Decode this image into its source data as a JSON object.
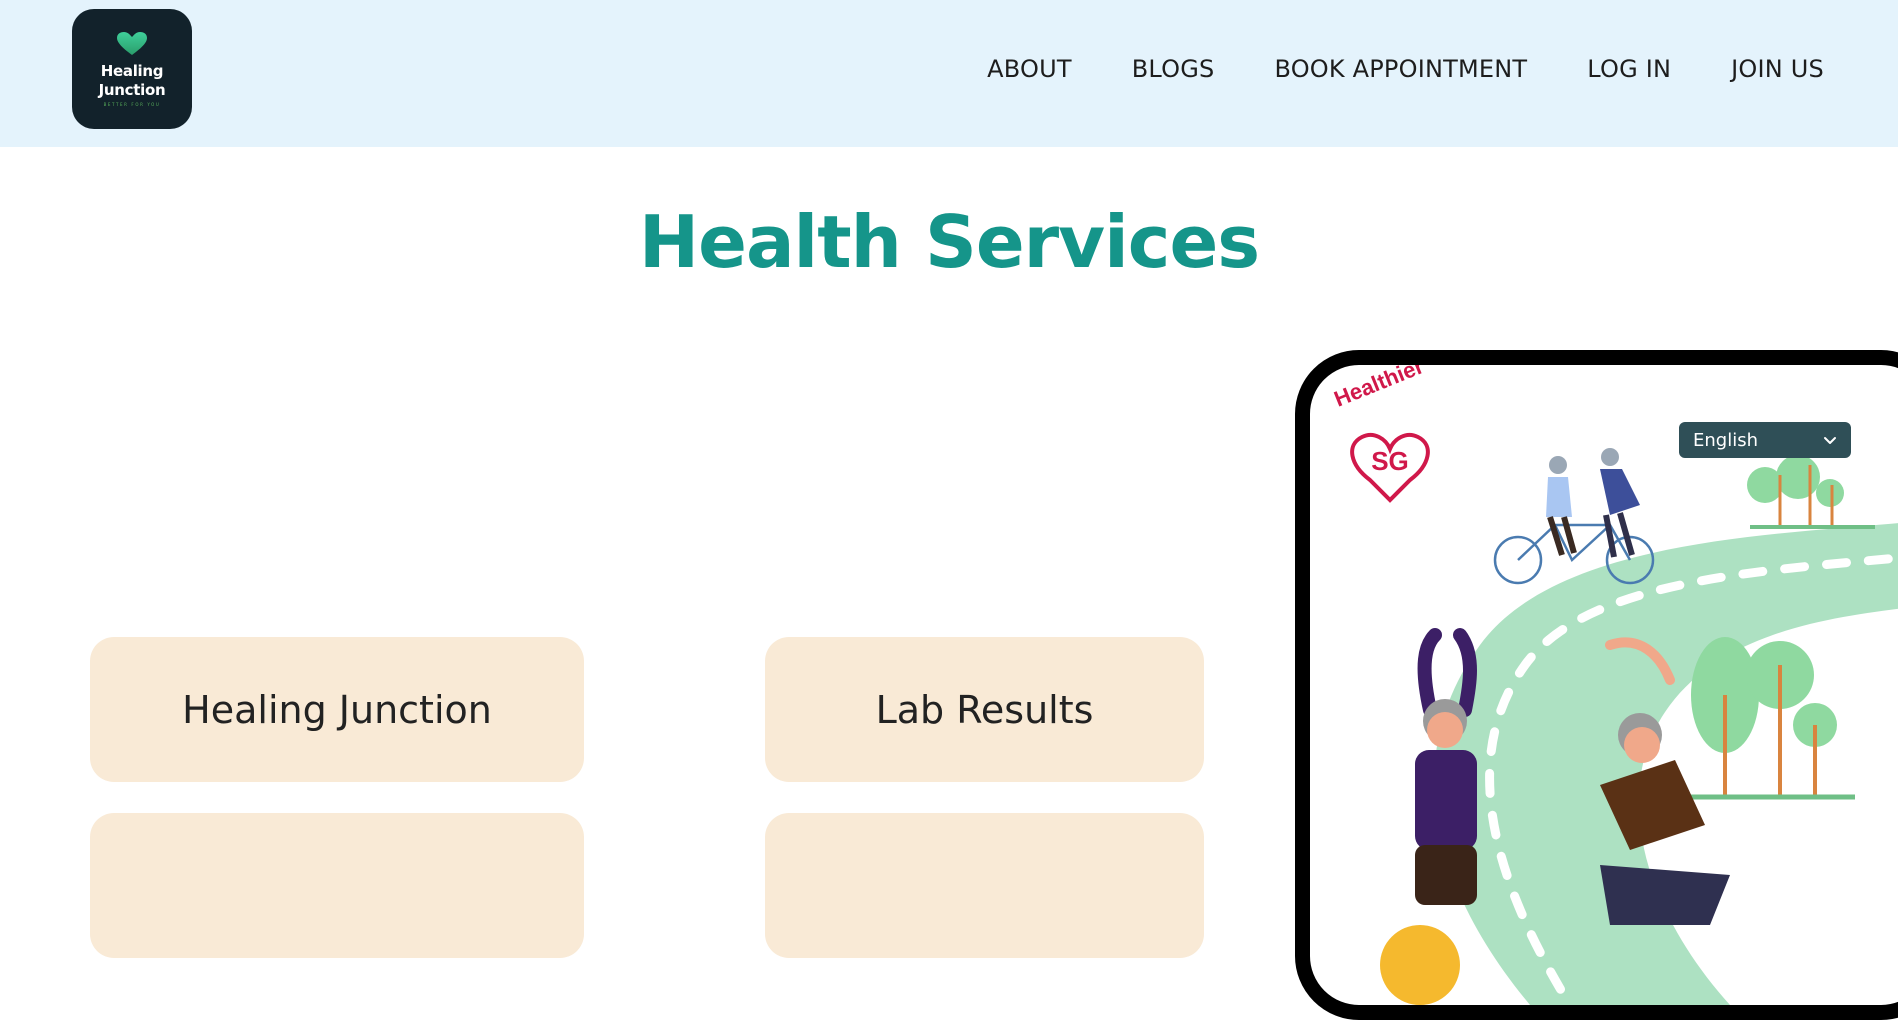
{
  "logo": {
    "line1": "Healing",
    "line2": "Junction",
    "tagline": "BETTER FOR YOU",
    "icon": "heart-icon"
  },
  "nav": {
    "about": "ABOUT",
    "blogs": "BLOGS",
    "book": "BOOK APPOINTMENT",
    "login": "LOG IN",
    "join": "JOIN US"
  },
  "page": {
    "title": "Health Services"
  },
  "services": {
    "card1": "Healing Junction",
    "card2": "Lab Results",
    "card3": "",
    "card4": ""
  },
  "phone": {
    "brand_top": "Healthier",
    "brand_bottom": "SG",
    "language": {
      "selected": "English",
      "icon": "chevron-down-icon"
    }
  },
  "colors": {
    "header_bg": "#e4f3fc",
    "title": "#15958a",
    "card_bg": "#f9ead6",
    "healthier_sg": "#d0184a"
  }
}
